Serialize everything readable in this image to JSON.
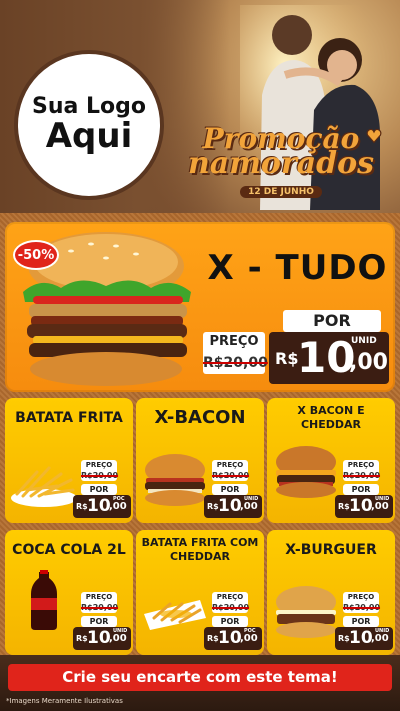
{
  "header": {
    "logo_line1": "Sua Logo",
    "logo_line2": "Aqui",
    "promo_title_line1": "Promoção",
    "promo_title_line2": "namorados",
    "promo_date": "12 DE JUNHO"
  },
  "hero": {
    "discount_badge": "-50%",
    "name": "X - TUDO",
    "preco_label": "PREÇO",
    "old_price": "R$20,00",
    "por_label": "POR",
    "currency": "R$",
    "price_int": "10",
    "price_cents": ",00",
    "unit": "UNID"
  },
  "cards": [
    {
      "title": "BATATA FRITA",
      "preco_label": "PREÇO",
      "old_price": "R$20,00",
      "por_label": "POR",
      "currency": "R$",
      "price_int": "10",
      "price_cents": ",00",
      "unit": "POC"
    },
    {
      "title": "X-BACON",
      "preco_label": "PREÇO",
      "old_price": "R$20,00",
      "por_label": "POR",
      "currency": "R$",
      "price_int": "10",
      "price_cents": ",00",
      "unit": "UNID"
    },
    {
      "title": "X BACON E CHEDDAR",
      "preco_label": "PREÇO",
      "old_price": "R$20,00",
      "por_label": "POR",
      "currency": "R$",
      "price_int": "10",
      "price_cents": ",00",
      "unit": "UNID"
    },
    {
      "title": "COCA COLA 2L",
      "preco_label": "PREÇO",
      "old_price": "R$20,00",
      "por_label": "POR",
      "currency": "R$",
      "price_int": "10",
      "price_cents": ",00",
      "unit": "UNID"
    },
    {
      "title": "BATATA FRITA COM CHEDDAR",
      "preco_label": "PREÇO",
      "old_price": "R$20,00",
      "por_label": "POR",
      "currency": "R$",
      "price_int": "10",
      "price_cents": ",00",
      "unit": "POC"
    },
    {
      "title": "X-BURGUER",
      "preco_label": "PREÇO",
      "old_price": "R$20,00",
      "por_label": "POR",
      "currency": "R$",
      "price_int": "10",
      "price_cents": ",00",
      "unit": "UNID"
    }
  ],
  "footer": {
    "cta": "Crie seu encarte com este tema!",
    "footnote": "*Imagens Meramente Ilustrativas"
  },
  "colors": {
    "accent_orange": "#f68c0e",
    "card_yellow": "#ffcc00",
    "price_dark": "#3b1d12",
    "cta_red": "#e0241b"
  }
}
